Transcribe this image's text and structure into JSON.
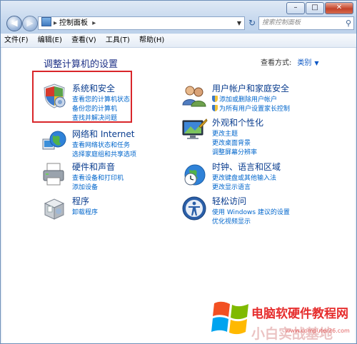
{
  "window": {
    "minimize_glyph": "–",
    "maximize_glyph": "□",
    "close_glyph": "✕"
  },
  "nav": {
    "back_glyph": "◀",
    "forward_glyph": "▶",
    "address_sep": "▸",
    "address": "控制面板",
    "address_sep2": "▸",
    "dropdown_glyph": "▼",
    "refresh_glyph": "↻",
    "search_placeholder": "搜索控制面板",
    "search_glyph": "⚲"
  },
  "menu": {
    "items": [
      "文件(F)",
      "编辑(E)",
      "查看(V)",
      "工具(T)",
      "帮助(H)"
    ]
  },
  "content": {
    "heading": "调整计算机的设置",
    "view_by_label": "查看方式:",
    "view_by_value": "类别",
    "view_by_arrow": "▼"
  },
  "categories": {
    "system": {
      "title": "系统和安全",
      "links": [
        "查看您的计算机状态",
        "备份您的计算机",
        "查找并解决问题"
      ],
      "icon": "system-security-shield-icon"
    },
    "network": {
      "title": "网络和 Internet",
      "links": [
        "查看网络状态和任务",
        "选择家庭组和共享选项"
      ],
      "icon": "network-globe-icon"
    },
    "hardware": {
      "title": "硬件和声音",
      "links": [
        "查看设备和打印机",
        "添加设备"
      ],
      "icon": "printer-icon"
    },
    "programs": {
      "title": "程序",
      "links": [
        "卸载程序"
      ],
      "icon": "programs-box-icon"
    },
    "users": {
      "title": "用户帐户和家庭安全",
      "links": [
        "添加或删除用户帐户",
        "为所有用户设置家长控制"
      ],
      "icon": "users-icon"
    },
    "appearance": {
      "title": "外观和个性化",
      "links": [
        "更改主题",
        "更改桌面背景",
        "调整屏幕分辨率"
      ],
      "icon": "monitor-icon"
    },
    "clock": {
      "title": "时钟、语言和区域",
      "links": [
        "更改键盘或其他输入法",
        "更改显示语言"
      ],
      "icon": "clock-globe-icon"
    },
    "ease": {
      "title": "轻松访问",
      "links": [
        "使用 Windows 建议的设置",
        "优化视频显示"
      ],
      "icon": "ease-of-access-icon"
    }
  },
  "watermark": {
    "title": "电脑软硬件教程网",
    "subtitle": "小白实战基地",
    "url": "www.computer26.com"
  },
  "colors": {
    "highlight": "#d9262a",
    "link": "#0066cc",
    "category_title": "#0a3d8f"
  }
}
